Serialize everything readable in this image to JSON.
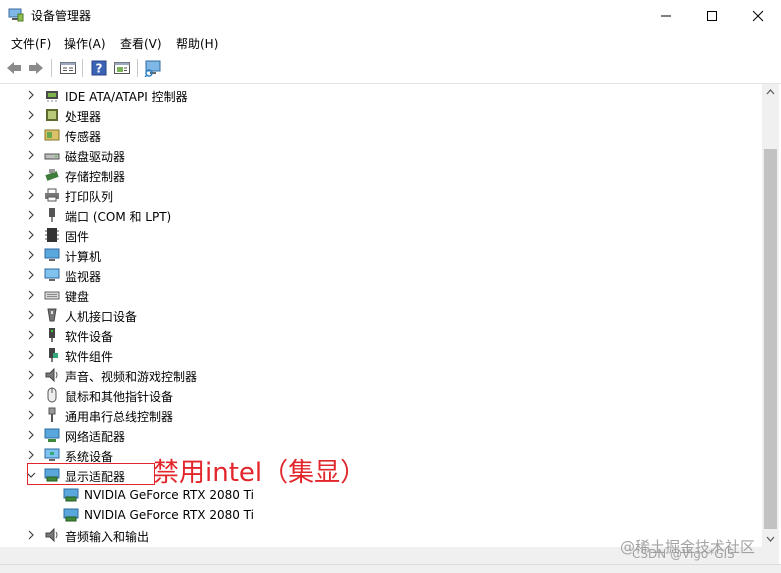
{
  "window": {
    "title": "设备管理器"
  },
  "menu": [
    "文件(F)",
    "操作(A)",
    "查看(V)",
    "帮助(H)"
  ],
  "toolbar": [
    "back-icon",
    "forward-icon",
    "properties-icon",
    "help-icon",
    "update-driver-icon",
    "scan-hardware-icon"
  ],
  "tree": [
    {
      "label": "IDE ATA/ATAPI 控制器",
      "icon": "ide-controller-icon",
      "expanded": false
    },
    {
      "label": "处理器",
      "icon": "processor-icon",
      "expanded": false
    },
    {
      "label": "传感器",
      "icon": "sensor-icon",
      "expanded": false
    },
    {
      "label": "磁盘驱动器",
      "icon": "disk-drive-icon",
      "expanded": false
    },
    {
      "label": "存储控制器",
      "icon": "storage-controller-icon",
      "expanded": false
    },
    {
      "label": "打印队列",
      "icon": "printer-icon",
      "expanded": false
    },
    {
      "label": "端口 (COM 和 LPT)",
      "icon": "port-icon",
      "expanded": false
    },
    {
      "label": "固件",
      "icon": "firmware-icon",
      "expanded": false
    },
    {
      "label": "计算机",
      "icon": "computer-icon",
      "expanded": false
    },
    {
      "label": "监视器",
      "icon": "monitor-icon",
      "expanded": false
    },
    {
      "label": "键盘",
      "icon": "keyboard-icon",
      "expanded": false
    },
    {
      "label": "人机接口设备",
      "icon": "hid-icon",
      "expanded": false
    },
    {
      "label": "软件设备",
      "icon": "software-device-icon",
      "expanded": false
    },
    {
      "label": "软件组件",
      "icon": "software-component-icon",
      "expanded": false
    },
    {
      "label": "声音、视频和游戏控制器",
      "icon": "sound-icon",
      "expanded": false
    },
    {
      "label": "鼠标和其他指针设备",
      "icon": "mouse-icon",
      "expanded": false
    },
    {
      "label": "通用串行总线控制器",
      "icon": "usb-icon",
      "expanded": false
    },
    {
      "label": "网络适配器",
      "icon": "network-adapter-icon",
      "expanded": false
    },
    {
      "label": "系统设备",
      "icon": "system-device-icon",
      "expanded": false
    },
    {
      "label": "显示适配器",
      "icon": "display-adapter-icon",
      "expanded": true,
      "children": [
        {
          "label": "NVIDIA GeForce RTX 2080 Ti",
          "icon": "display-adapter-icon"
        },
        {
          "label": "NVIDIA GeForce RTX 2080 Ti",
          "icon": "display-adapter-icon"
        }
      ]
    },
    {
      "label": "音频输入和输出",
      "icon": "audio-io-icon",
      "expanded": false
    }
  ],
  "annotation": {
    "text": "禁用intel（集显）",
    "color": "#e2262c"
  },
  "watermark": {
    "line1": "@稀土掘金技术社区",
    "line2": "CSDN @Vigo*GIS"
  }
}
